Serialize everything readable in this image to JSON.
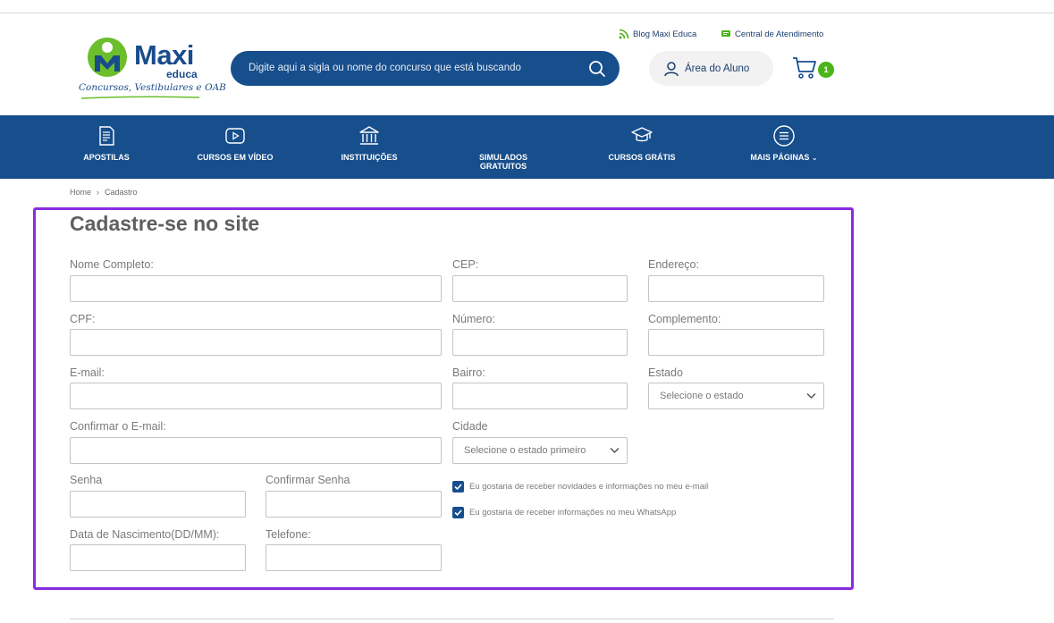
{
  "header": {
    "logo": {
      "brand": "Maxi",
      "sub": "educa",
      "tagline": "Concursos, Vestibulares e OAB"
    },
    "blog_link": "Blog Maxi Educa",
    "support_link": "Central de Atendimento",
    "search": {
      "placeholder": "Digite aqui a sigla ou nome do concurso que está buscando"
    },
    "student_area": "Área do Aluno",
    "cart_count": "1"
  },
  "nav": {
    "items": [
      {
        "label": "APOSTILAS",
        "icon": "document-icon"
      },
      {
        "label": "CURSOS EM VÍDEO",
        "icon": "video-icon"
      },
      {
        "label": "INSTITUIÇÕES",
        "icon": "institution-icon"
      },
      {
        "label": "SIMULADOS GRATUITOS",
        "icon": "none"
      },
      {
        "label": "CURSOS GRÁTIS",
        "icon": "graduation-cap-icon"
      },
      {
        "label": "MAIS PÁGINAS",
        "icon": "menu-circle-icon"
      }
    ]
  },
  "breadcrumb": {
    "home": "Home",
    "separator": "›",
    "current": "Cadastro"
  },
  "form": {
    "title": "Cadastre-se no site",
    "labels": {
      "nome": "Nome Completo:",
      "cpf": "CPF:",
      "email": "E-mail:",
      "confirm_email": "Confirmar o E-mail:",
      "senha": "Senha",
      "confirm_senha": "Confirmar Senha",
      "nascimento": "Data de Nascimento(DD/MM):",
      "telefone": "Telefone:",
      "cep": "CEP:",
      "numero": "Número:",
      "bairro": "Bairro:",
      "cidade": "Cidade",
      "endereco": "Endereço:",
      "complemento": "Complemento:",
      "estado": "Estado"
    },
    "values": {
      "nome": "",
      "cpf": "",
      "email": "",
      "confirm_email": "",
      "senha": "",
      "confirm_senha": "",
      "nascimento": "",
      "telefone": "",
      "cep": "",
      "numero": "",
      "bairro": "",
      "endereco": "",
      "complemento": ""
    },
    "estado_select": "Selecione o estado",
    "cidade_select": "Selecione o estado primeiro",
    "checkboxes": [
      {
        "label": "Eu gostaria de receber novidades e informações no meu e-mail",
        "checked": true
      },
      {
        "label": "Eu gostaria de receber informações no meu WhatsApp",
        "checked": true
      }
    ]
  },
  "colors": {
    "brand_blue": "#174e8c",
    "accent_green": "#4ab519",
    "highlight_border": "#8a2be2"
  }
}
